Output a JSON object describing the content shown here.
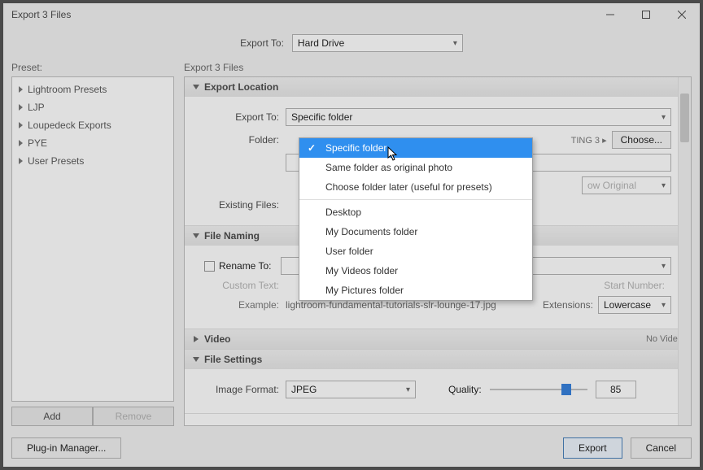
{
  "window": {
    "title": "Export 3 Files"
  },
  "exportToTop": {
    "label": "Export To:",
    "value": "Hard Drive"
  },
  "left": {
    "label": "Preset:",
    "presets": [
      "Lightroom Presets",
      "LJP",
      "Loupedeck Exports",
      "PYE",
      "User Presets"
    ],
    "addBtn": "Add",
    "removeBtn": "Remove"
  },
  "right": {
    "label": "Export 3 Files",
    "exportLocation": {
      "header": "Export Location",
      "exportToLabel": "Export To:",
      "exportToValue": "Specific folder",
      "folderLabel": "Folder:",
      "folderPathTail": "TING 3 ▸",
      "chooseBtn": "Choose...",
      "belowOriginal": "ow Original",
      "existingLabel": "Existing Files:"
    },
    "dropdown": {
      "items": [
        "Specific folder",
        "Same folder as original photo",
        "Choose folder later (useful for presets)"
      ],
      "items2": [
        "Desktop",
        "My Documents folder",
        "User folder",
        "My Videos folder",
        "My Pictures folder"
      ],
      "selected": 0
    },
    "fileNaming": {
      "header": "File Naming",
      "renameTo": "Rename To:",
      "customText": "Custom Text:",
      "startNumber": "Start Number:",
      "exampleLabel": "Example:",
      "exampleValue": "lightroom-fundamental-tutorials-slr-lounge-17.jpg",
      "extensionsLabel": "Extensions:",
      "extensionsValue": "Lowercase"
    },
    "video": {
      "header": "Video",
      "right": "No Video"
    },
    "fileSettings": {
      "header": "File Settings",
      "imageFormatLabel": "Image Format:",
      "imageFormatValue": "JPEG",
      "qualityLabel": "Quality:",
      "qualityValue": "85"
    }
  },
  "footer": {
    "plugin": "Plug-in Manager...",
    "export": "Export",
    "cancel": "Cancel"
  }
}
